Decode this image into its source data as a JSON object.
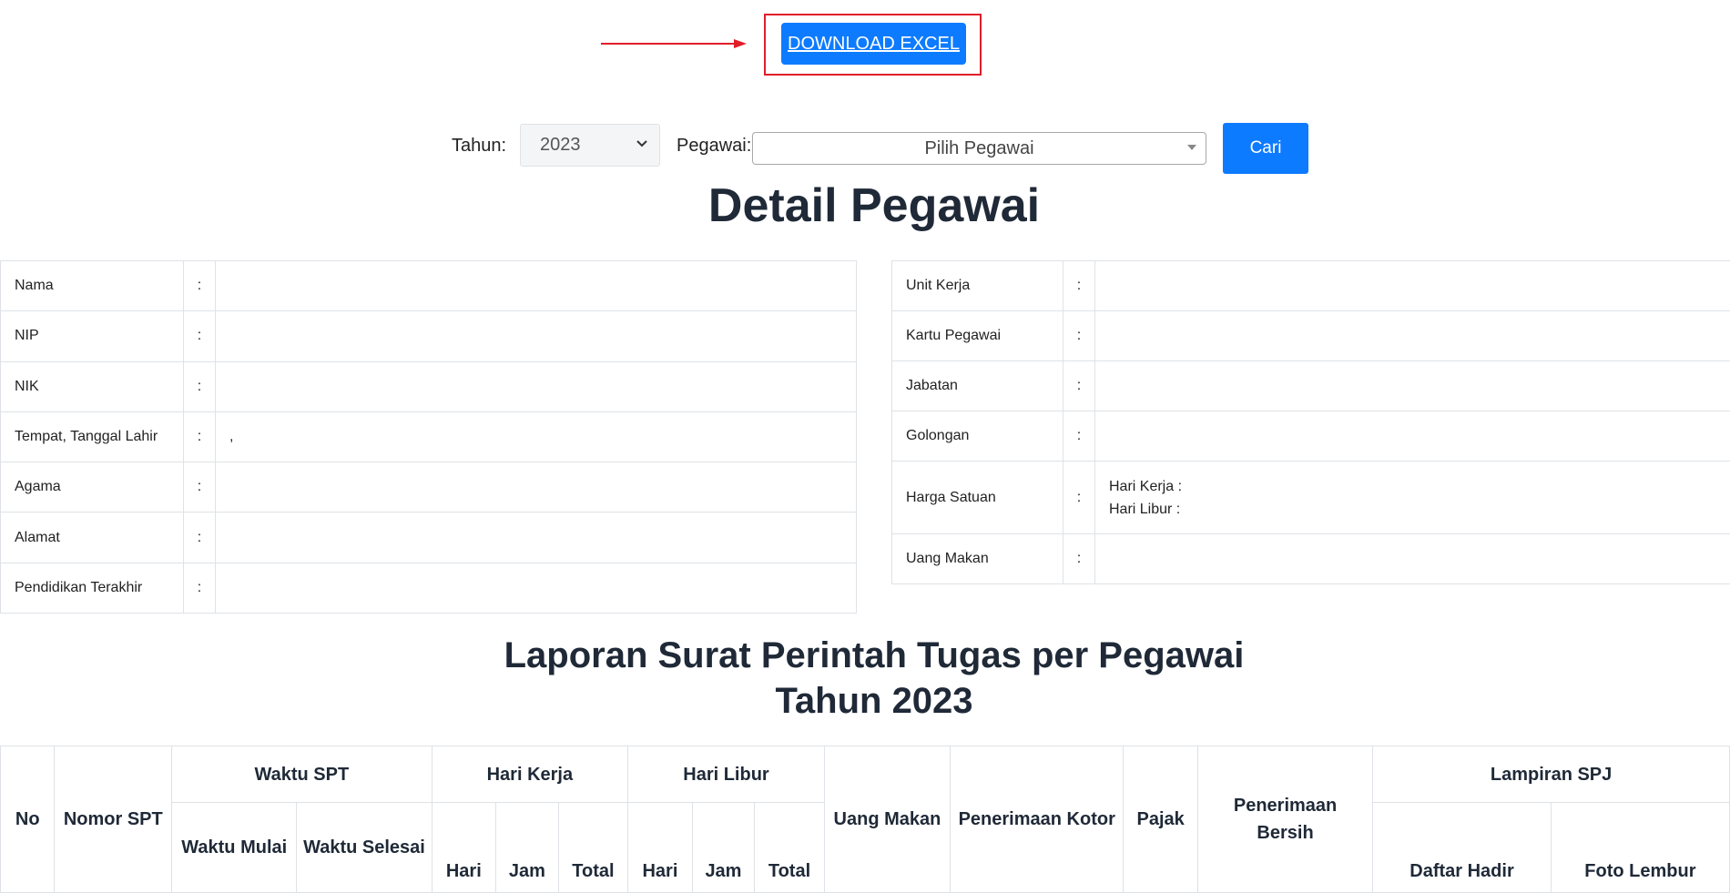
{
  "download": {
    "label": "DOWNLOAD EXCEL"
  },
  "filters": {
    "tahun_label": "Tahun:",
    "tahun_value": "2023",
    "pegawai_label": "Pegawai:",
    "pegawai_placeholder": "Pilih Pegawai",
    "search_label": "Cari"
  },
  "detail": {
    "title": "Detail Pegawai",
    "left": [
      {
        "label": "Nama",
        "colon": ":",
        "value": ""
      },
      {
        "label": "NIP",
        "colon": ":",
        "value": ""
      },
      {
        "label": "NIK",
        "colon": ":",
        "value": ""
      },
      {
        "label": "Tempat, Tanggal Lahir",
        "colon": ":",
        "value": ","
      },
      {
        "label": "Agama",
        "colon": ":",
        "value": ""
      },
      {
        "label": "Alamat",
        "colon": ":",
        "value": ""
      },
      {
        "label": "Pendidikan Terakhir",
        "colon": ":",
        "value": ""
      }
    ],
    "right": [
      {
        "label": "Unit Kerja",
        "colon": ":",
        "value": ""
      },
      {
        "label": "Kartu Pegawai",
        "colon": ":",
        "value": ""
      },
      {
        "label": "Jabatan",
        "colon": ":",
        "value": ""
      },
      {
        "label": "Golongan",
        "colon": ":",
        "value": ""
      },
      {
        "label": "Harga Satuan",
        "colon": ":",
        "hari_kerja": "Hari Kerja :",
        "hari_libur": "Hari Libur :"
      },
      {
        "label": "Uang Makan",
        "colon": ":",
        "value": ""
      }
    ]
  },
  "report": {
    "title_line1": "Laporan Surat Perintah Tugas per Pegawai",
    "title_line2": "Tahun 2023",
    "headers": {
      "no": "No",
      "nomor_spt": "Nomor SPT",
      "waktu_spt": "Waktu SPT",
      "waktu_mulai": "Waktu Mulai",
      "waktu_selesai": "Waktu Selesai",
      "hari_kerja": "Hari Kerja",
      "hari_libur": "Hari Libur",
      "hari": "Hari",
      "jam": "Jam",
      "total": "Total",
      "uang_makan": "Uang Makan",
      "penerimaan_kotor": "Penerimaan Kotor",
      "pajak": "Pajak",
      "penerimaan_bersih": "Penerimaan Bersih",
      "lampiran_spj": "Lampiran SPJ",
      "daftar_hadir": "Daftar Hadir",
      "foto_lembur": "Foto Lembur"
    }
  },
  "colors": {
    "primary": "#0d7bff",
    "annotation": "#e11d2a",
    "heading": "#1f2937",
    "border": "#dee2e6"
  }
}
